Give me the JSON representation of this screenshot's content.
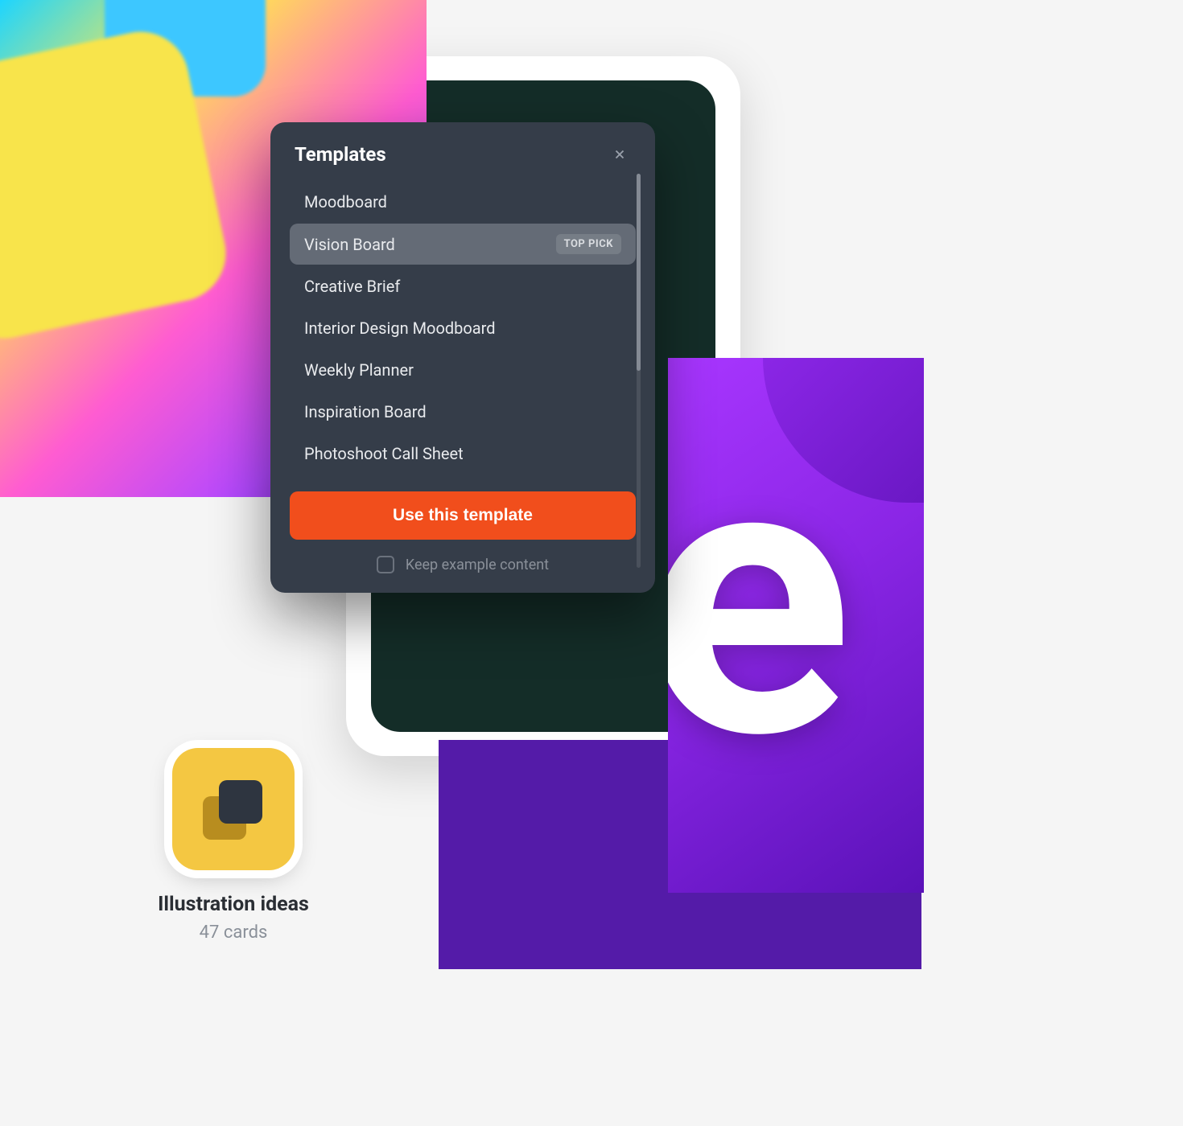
{
  "modal": {
    "title": "Templates",
    "items": [
      {
        "label": "Moodboard",
        "selected": false,
        "badge": null
      },
      {
        "label": "Vision Board",
        "selected": true,
        "badge": "TOP PICK"
      },
      {
        "label": "Creative Brief",
        "selected": false,
        "badge": null
      },
      {
        "label": "Interior Design Moodboard",
        "selected": false,
        "badge": null
      },
      {
        "label": "Weekly Planner",
        "selected": false,
        "badge": null
      },
      {
        "label": "Inspiration Board",
        "selected": false,
        "badge": null
      },
      {
        "label": "Photoshoot Call Sheet",
        "selected": false,
        "badge": null
      }
    ],
    "cta": "Use this template",
    "keep_label": "Keep example content"
  },
  "folder": {
    "title": "Illustration ideas",
    "count": "47 cards"
  },
  "colors": {
    "modal_bg": "#353d49",
    "accent": "#f14e1c",
    "folder_icon": "#f4c742"
  }
}
